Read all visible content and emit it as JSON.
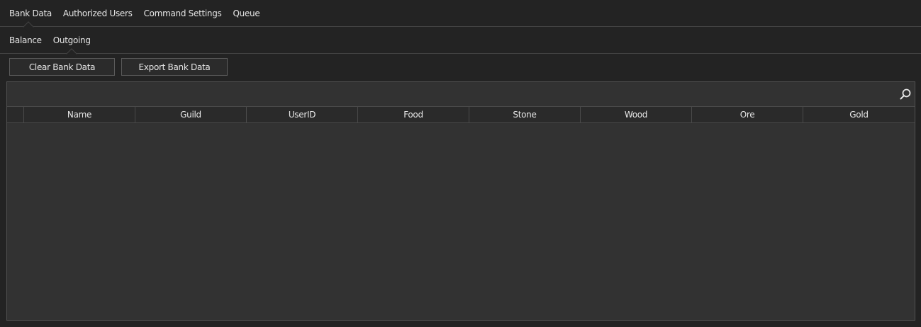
{
  "main_tabs": [
    {
      "label": "Bank Data",
      "active": true
    },
    {
      "label": "Authorized Users",
      "active": false
    },
    {
      "label": "Command Settings",
      "active": false
    },
    {
      "label": "Queue",
      "active": false
    }
  ],
  "sub_tabs": [
    {
      "label": "Balance",
      "active": false
    },
    {
      "label": "Outgoing",
      "active": true
    }
  ],
  "toolbar": {
    "clear_label": "Clear Bank Data",
    "export_label": "Export Bank Data"
  },
  "grid": {
    "search_icon": "search-icon",
    "columns": [
      "Name",
      "Guild",
      "UserID",
      "Food",
      "Stone",
      "Wood",
      "Ore",
      "Gold"
    ],
    "rows": []
  },
  "colors": {
    "background": "#232323",
    "grid_background": "#323232",
    "text": "#e6e6e6",
    "border": "#444444"
  }
}
